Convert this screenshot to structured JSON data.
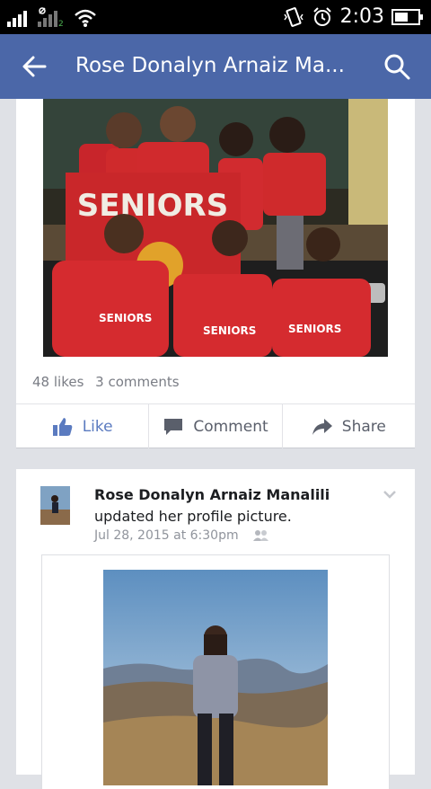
{
  "status": {
    "time": "2:03",
    "sim2": "2"
  },
  "header": {
    "title": "Rose Donalyn Arnaiz Ma..."
  },
  "post1": {
    "photo_text": "SENIORS",
    "likes": "48 likes",
    "comments": "3 comments"
  },
  "actions": {
    "like": "Like",
    "comment": "Comment",
    "share": "Share"
  },
  "post2": {
    "author": "Rose Donalyn Arnaiz Manalili",
    "description": "updated her profile picture.",
    "time": "Jul 28, 2015 at 6:30pm"
  },
  "colors": {
    "brand": "#4b67a8",
    "like": "#5b7bc0"
  }
}
